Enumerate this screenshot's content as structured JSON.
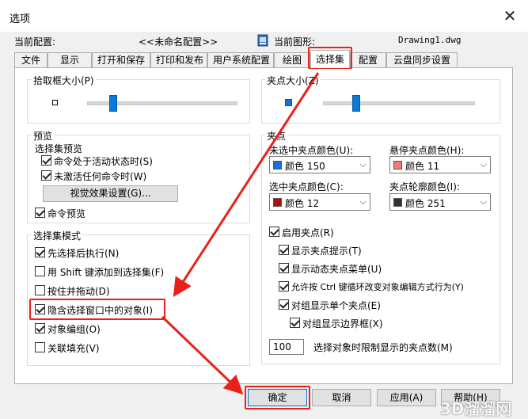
{
  "window": {
    "title": "选项",
    "close_symbol": "✕"
  },
  "profile": {
    "current_profile_label": "当前配置:",
    "current_profile_value": "<<未命名配置>>",
    "current_drawing_label": "当前图形:",
    "current_drawing_value": "Drawing1.dwg"
  },
  "tabs": [
    {
      "label": "文件"
    },
    {
      "label": "显示"
    },
    {
      "label": "打开和保存"
    },
    {
      "label": "打印和发布"
    },
    {
      "label": "用户系统配置"
    },
    {
      "label": "绘图"
    },
    {
      "label": "选择集"
    },
    {
      "label": "配置"
    },
    {
      "label": "云盘同步设置"
    }
  ],
  "pickbox": {
    "label": "拾取框大小(P)",
    "slider_fraction": 0.17
  },
  "grip_size": {
    "label": "夹点大小(Z)",
    "slider_fraction": 0.2
  },
  "preview": {
    "label": "预览",
    "selection_preview_label": "选择集预览",
    "when_command_active": {
      "label": "命令处于活动状态时(S)",
      "checked": true
    },
    "when_no_command": {
      "label": "未激活任何命令时(W)",
      "checked": true
    },
    "visual_effects_button": "视觉效果设置(G)...",
    "command_preview": {
      "label": "命令预览",
      "checked": true
    }
  },
  "selection_modes": {
    "label": "选择集模式",
    "items": [
      {
        "label": "先选择后执行(N)",
        "checked": true
      },
      {
        "label": "用 Shift 键添加到选择集(F)",
        "checked": false
      },
      {
        "label": "按住并拖动(D)",
        "checked": false
      },
      {
        "label": "隐含选择窗口中的对象(I)",
        "checked": true
      },
      {
        "label": "对象编组(O)",
        "checked": true
      },
      {
        "label": "关联填充(V)",
        "checked": false
      }
    ]
  },
  "grips": {
    "label": "夹点",
    "unselected_color_label": "未选中夹点颜色(U):",
    "unselected_color": {
      "text": "颜色 150",
      "swatch": "#1a6fe0"
    },
    "hover_color_label": "悬停夹点颜色(H):",
    "hover_color": {
      "text": "颜色 11",
      "swatch": "#f07a7a"
    },
    "selected_color_label": "选中夹点颜色(C):",
    "selected_color": {
      "text": "颜色 12",
      "swatch": "#b01010"
    },
    "contour_color_label": "夹点轮廓颜色(I):",
    "contour_color": {
      "text": "颜色 251",
      "swatch": "#333333"
    },
    "show_grips": {
      "label": "启用夹点(R)",
      "checked": true
    },
    "show_grip_tips": {
      "label": "显示夹点提示(T)",
      "checked": true
    },
    "show_dynamic_menu": {
      "label": "显示动态夹点菜单(U)",
      "checked": true
    },
    "allow_ctrl_cycle": {
      "label": "允许按 Ctrl 键循环改变对象编辑方式行为(Y)",
      "checked": true
    },
    "show_single_grip_groups": {
      "label": "对组显示单个夹点(E)",
      "checked": true
    },
    "show_group_bbox": {
      "label": "对组显示边界框(X)",
      "checked": true
    },
    "grip_limit_value": "100",
    "grip_limit_label": "选择对象时限制显示的夹点数(M)"
  },
  "buttons": {
    "ok": "确定",
    "cancel": "取消",
    "apply": "应用(A)",
    "help": "帮助(H)"
  },
  "watermark": "3D溜溜网",
  "colors": {
    "highlight_red": "#e8221a",
    "slider_blue": "#0a79d7"
  }
}
